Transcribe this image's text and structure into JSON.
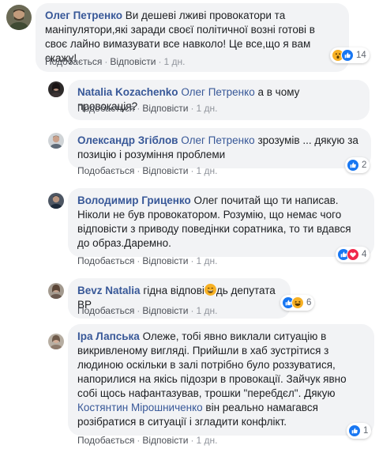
{
  "actions": {
    "like": "Подобається",
    "reply": "Відповісти",
    "sep": "·"
  },
  "comments": [
    {
      "author": "Олег Петренко",
      "text": "Ви дешеві лживі провокатори та маніпулятори,які заради своєї політичної возні готові в своє лайно вимазувати все навколо! Це все,що я вам скажу!",
      "time": "1 дн.",
      "reactions": {
        "icons": [
          "wow-icon",
          "like-icon"
        ],
        "count": "14"
      }
    },
    {
      "author": "Natalia Kozachenko",
      "mention": "Олег Петренко",
      "text": "а в чому провокація?",
      "time": "1 дн."
    },
    {
      "author": "Олександр Згіблов",
      "mention": "Олег Петренко",
      "text": "зрозумів ... дякую за позицію і розуміння проблеми",
      "time": "1 дн.",
      "reactions": {
        "icons": [
          "like-icon"
        ],
        "count": "2"
      }
    },
    {
      "author": "Володимир Гриценко",
      "text": "Олег почитай що ти написав. Ніколи не був провокатором. Розумію, що немає чого відповісти з приводу поведінки соратника, то ти вдався до образ.Даремно.",
      "time": "1 дн.",
      "reactions": {
        "icons": [
          "like-icon",
          "love-icon"
        ],
        "count": "4"
      }
    },
    {
      "author": "Bevz Natalia",
      "text_before": "гідна відпові",
      "text_after": "дь депутата ВР",
      "time": "1 дн.",
      "reactions": {
        "icons": [
          "like-icon",
          "haha-icon"
        ],
        "count": "6"
      }
    },
    {
      "author": "Іра Лапська",
      "text": "Олеже, тобі явно виклали ситуацію в викривленому вигляді. Прийшли в хаб зустрітися з людиною оскільки в залі потрібно було роззуватися, напорилися на якісь підозри в провокації. Зайчук явно собі щось нафантазував, трошки \"перебдєл\". Дякую",
      "mention": "Костянтин Мірошниченко",
      "text_after": "він реально намагався розібратися в ситуації і згладити конфлікт.",
      "time": "1 дн.",
      "reactions": {
        "icons": [
          "like-icon"
        ],
        "count": "1"
      }
    }
  ],
  "colors": {
    "link": "#385898",
    "bubble": "#f2f3f5",
    "like": "#1877f2",
    "love": "#f0284a",
    "yellow": "#f7b125"
  }
}
